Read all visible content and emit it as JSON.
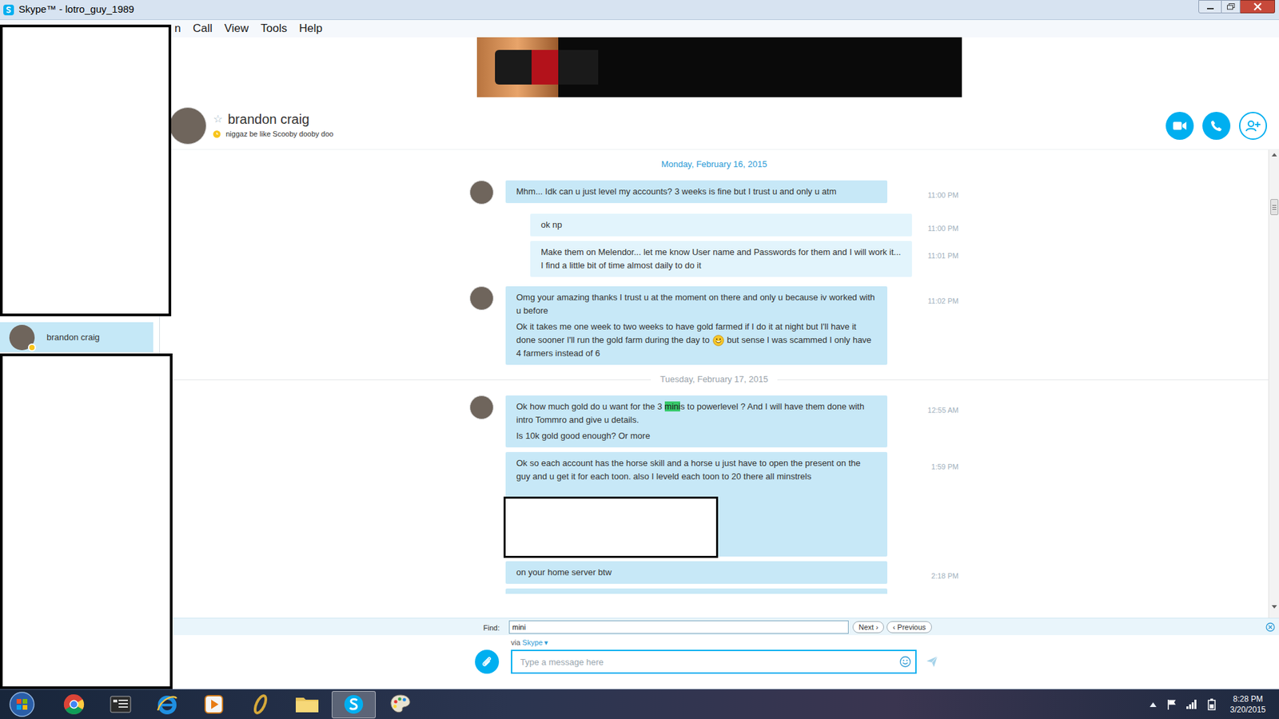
{
  "window": {
    "title": "Skype™ - lotro_guy_1989"
  },
  "menu": [
    "n",
    "Call",
    "View",
    "Tools",
    "Help"
  ],
  "contacts": [
    {
      "name": "brandon craig",
      "selected": true,
      "presence": "away"
    }
  ],
  "conversation": {
    "name": "brandon craig",
    "star": "☆",
    "mood": "niggaz be like Scooby dooby doo",
    "presence": "away"
  },
  "chat": [
    {
      "kind": "pinned-date",
      "text": "Monday, February 16, 2015"
    },
    {
      "kind": "message",
      "side": "incoming",
      "avatar": true,
      "time": "11:00 PM",
      "paragraphs": [
        [
          {
            "kind": "text",
            "text": "Mhm... Idk can u just level my accounts? 3 weeks is fine but I trust u and only u atm"
          }
        ]
      ]
    },
    {
      "kind": "message",
      "side": "outgoing",
      "avatar": false,
      "time": "11:00 PM",
      "paragraphs": [
        [
          {
            "kind": "text",
            "text": "ok np"
          }
        ]
      ]
    },
    {
      "kind": "message",
      "side": "outgoing",
      "avatar": false,
      "time": "11:01 PM",
      "paragraphs": [
        [
          {
            "kind": "text",
            "text": "Make them on Melendor... let me know User name and Passwords for them and I will work it... I find a little bit of time almost daily to do it"
          }
        ]
      ]
    },
    {
      "kind": "message",
      "side": "incoming",
      "avatar": true,
      "time": "11:02 PM",
      "paragraphs": [
        [
          {
            "kind": "text",
            "text": "Omg your amazing thanks I trust u at the moment on there and only u because iv worked with u before"
          }
        ],
        [
          {
            "kind": "text",
            "text": "Ok it takes me one week to two weeks to have gold farmed if I do it at night but I'll have it done sooner I'll run the gold farm during the day to "
          },
          {
            "kind": "emoji"
          },
          {
            "kind": "text",
            "text": " but sense I was scammed I only have 4 farmers instead of 6"
          }
        ]
      ]
    },
    {
      "kind": "divider-date",
      "text": "Tuesday, February 17, 2015"
    },
    {
      "kind": "message",
      "side": "incoming",
      "avatar": true,
      "time": "12:55 AM",
      "paragraphs": [
        [
          {
            "kind": "text",
            "text": "Ok how much gold do u want for the 3 "
          },
          {
            "kind": "match",
            "text": "mini"
          },
          {
            "kind": "text",
            "text": "s to powerlevel ? And I will have them done with intro Tommro and give u details."
          }
        ],
        [
          {
            "kind": "text",
            "text": "Is 10k gold good enough? Or more"
          }
        ]
      ]
    },
    {
      "kind": "message",
      "side": "incoming",
      "avatar": false,
      "time": "1:59 PM",
      "paragraphs": [
        [
          {
            "kind": "text",
            "text": "Ok so each account has the horse skill and a horse u just have to open the present on the guy and u get it for each toon. also I leveld each toon to 20 there all minstrels"
          }
        ],
        [
          {
            "kind": "redacted"
          }
        ]
      ]
    },
    {
      "kind": "message",
      "side": "incoming",
      "avatar": false,
      "time": "2:18 PM",
      "paragraphs": [
        [
          {
            "kind": "text",
            "text": "on your home server btw"
          }
        ]
      ]
    },
    {
      "kind": "message",
      "side": "incoming",
      "avatar": false,
      "paragraphs": []
    }
  ],
  "find": {
    "label": "Find:",
    "value": "mini",
    "next": "Next ›",
    "previous": "‹ Previous"
  },
  "via": {
    "label": "via",
    "service": "Skype",
    "arrow": "▾"
  },
  "compose": {
    "placeholder": "Type a message here"
  },
  "taskbar": {
    "apps": [
      {
        "kind": "chrome",
        "active": false
      },
      {
        "kind": "tasks",
        "active": false
      },
      {
        "kind": "ie",
        "active": false
      },
      {
        "kind": "media",
        "active": false
      },
      {
        "kind": "ring",
        "active": false
      },
      {
        "kind": "folder",
        "active": false
      },
      {
        "kind": "skype",
        "active": true
      },
      {
        "kind": "paint",
        "active": false
      }
    ],
    "time": "8:28 PM",
    "date": "3/20/2015"
  }
}
